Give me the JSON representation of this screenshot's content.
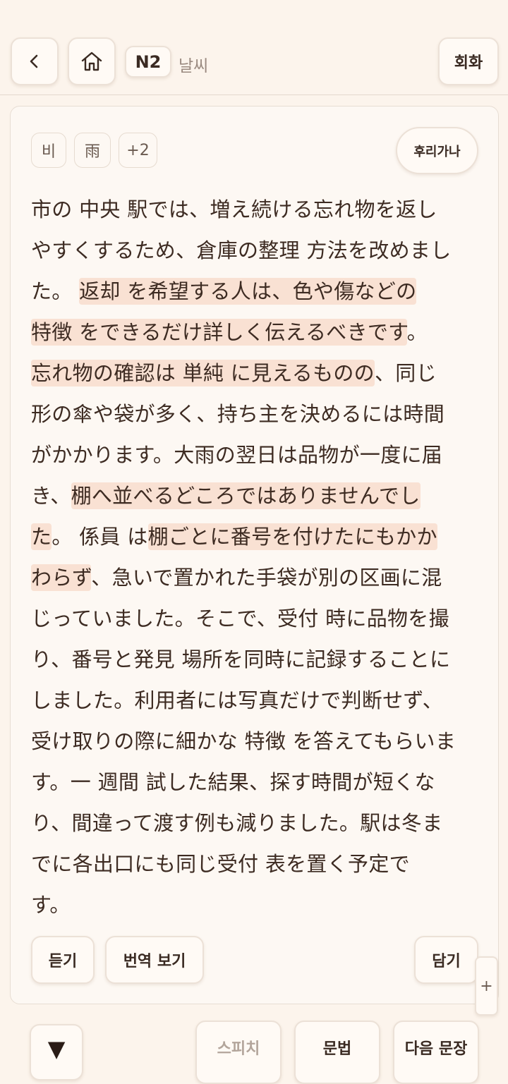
{
  "header": {
    "level": "N2",
    "topic": "날씨",
    "conversation_label": "회화"
  },
  "tags": [
    "비",
    "雨",
    "+2"
  ],
  "furigana_label": "후리가나",
  "passage_lines": [
    [
      {
        "t": "市の 中央  駅では、増え続ける忘れ物を返し",
        "h": false
      }
    ],
    [
      {
        "t": "やすくするため、倉庫の整理 方法を改めまし",
        "h": false
      }
    ],
    [
      {
        "t": "た。 ",
        "h": false
      },
      {
        "t": " 返却 を希望する人は、色や傷などの",
        "h": true
      }
    ],
    [
      {
        "t": " 特徴 をできるだけ詳しく伝えるべきです",
        "h": true
      },
      {
        "t": "。",
        "h": false
      }
    ],
    [
      {
        "t": "忘れ物の確認は 単純 に見えるものの",
        "h": true
      },
      {
        "t": "、同じ",
        "h": false
      }
    ],
    [
      {
        "t": " 形の傘や袋が多く、持ち主を決めるには時間",
        "h": false
      }
    ],
    [
      {
        "t": "がかかります。大雨の翌日は品物が一度に届",
        "h": false
      }
    ],
    [
      {
        "t": "き、",
        "h": false
      },
      {
        "t": "棚へ並べるどころではありませんでし",
        "h": true
      }
    ],
    [
      {
        "t": "た",
        "h": true
      },
      {
        "t": "。 係員 は",
        "h": false
      },
      {
        "t": "棚ごとに番号を付けたにもかか",
        "h": true
      }
    ],
    [
      {
        "t": "わらず",
        "h": true
      },
      {
        "t": "、急いで置かれた手袋が別の区画に混",
        "h": false
      }
    ],
    [
      {
        "t": "じっていました。そこで、受付 時に品物を撮",
        "h": false
      }
    ],
    [
      {
        "t": "り、番号と発見 場所を同時に記録することに",
        "h": false
      }
    ],
    [
      {
        "t": "しました。利用者には写真だけで判断せず、",
        "h": false
      }
    ],
    [
      {
        "t": "受け取りの際に細かな 特徴 を答えてもらいま",
        "h": false
      }
    ],
    [
      {
        "t": "す。一  週間  試した結果、探す時間が短くな",
        "h": false
      }
    ],
    [
      {
        "t": "り、間違って渡す例も減りました。駅は冬ま",
        "h": false
      }
    ],
    [
      {
        "t": "でに各出口にも同じ受付  表を置く予定で",
        "h": false
      }
    ],
    [
      {
        "t": "す。",
        "h": false
      }
    ]
  ],
  "actions": {
    "listen": "듣기",
    "translate": "번역 보기",
    "save": "담기"
  },
  "side_handle": "+",
  "footer": {
    "toggle_symbol": "▼",
    "speech": "스피치",
    "grammar": "문법",
    "next_sentence": "다음 문장"
  },
  "colors": {
    "background": "#fcf4ec",
    "highlight": "#f9e1d3",
    "text": "#3d2b22"
  }
}
